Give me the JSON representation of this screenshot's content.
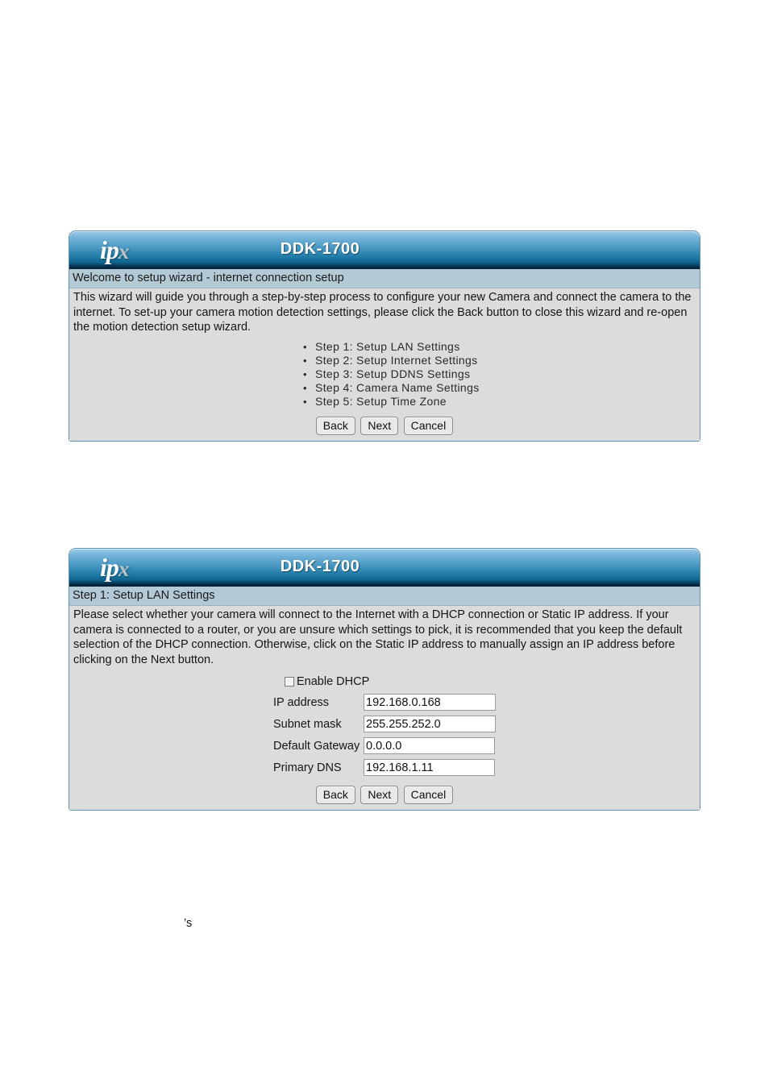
{
  "page": {
    "stray_fragment": "’s"
  },
  "panel1": {
    "logo_main": "ip",
    "logo_accent": "x",
    "model": "DDK-1700",
    "subtitle": "Welcome to setup wizard - internet connection setup",
    "intro": "This wizard will guide you through a step-by-step process to configure your new Camera and connect the camera to the internet. To set-up your camera motion detection settings, please click the Back button to close this wizard and re-open the motion detection setup wizard.",
    "steps": [
      "Step 1: Setup LAN Settings",
      "Step 2: Setup Internet Settings",
      "Step 3: Setup DDNS Settings",
      "Step 4: Camera Name Settings",
      "Step 5: Setup Time Zone"
    ],
    "buttons": {
      "back": "Back",
      "next": "Next",
      "cancel": "Cancel"
    }
  },
  "panel2": {
    "logo_main": "ip",
    "logo_accent": "x",
    "model": "DDK-1700",
    "subtitle": "Step 1: Setup LAN Settings",
    "intro": "Please select whether your camera will connect to the Internet with a DHCP connection or Static IP address. If your camera is connected to a router, or you are unsure which settings to pick, it is recommended that you keep the default selection of the DHCP connection. Otherwise, click on the Static IP address to manually assign an IP address before clicking on the Next button.",
    "dhcp_label": "Enable DHCP",
    "dhcp_checked": false,
    "fields": [
      {
        "label": "IP address",
        "value": "192.168.0.168"
      },
      {
        "label": "Subnet mask",
        "value": "255.255.252.0"
      },
      {
        "label": "Default Gateway",
        "value": "0.0.0.0"
      },
      {
        "label": "Primary DNS",
        "value": "192.168.1.11"
      }
    ],
    "buttons": {
      "back": "Back",
      "next": "Next",
      "cancel": "Cancel"
    }
  }
}
